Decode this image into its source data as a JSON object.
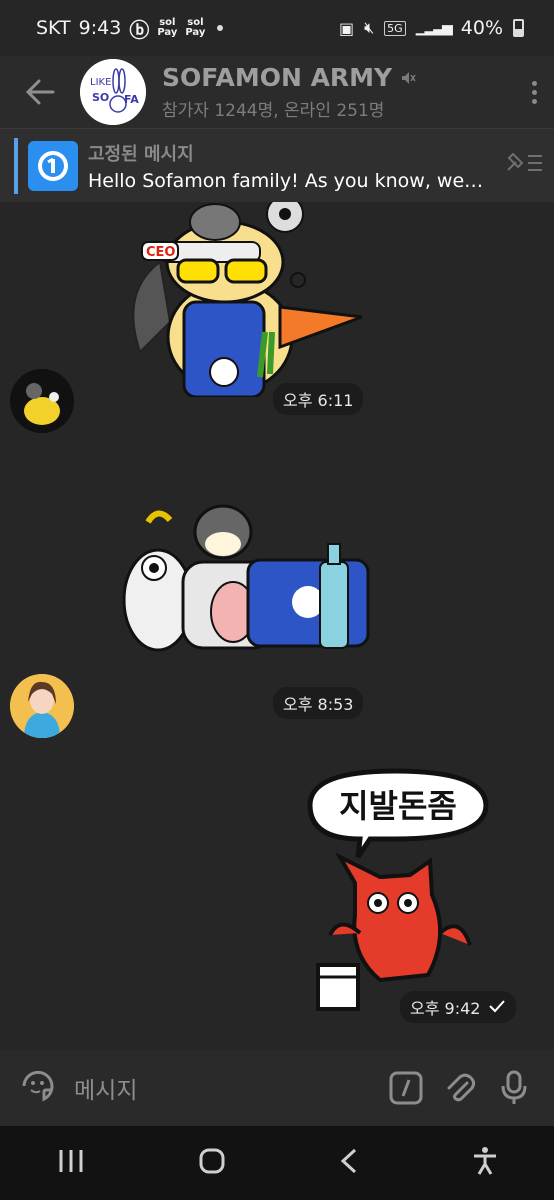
{
  "status": {
    "carrier": "SKT",
    "time": "9:43",
    "pay_a": "Pay",
    "pay_b": "Pay",
    "network": "5G",
    "battery": "40%"
  },
  "header": {
    "title": "SOFAMON ARMY",
    "subtitle": "참가자 1244명, 온라인 251명",
    "avatar_text_a": "LIKE",
    "avatar_text_b": "SO",
    "avatar_text_c": "FA"
  },
  "pinned": {
    "label": "고정된 메시지",
    "message": "Hello Sofamon family!  As you know, we’…"
  },
  "messages": [
    {
      "time": "오후 6:11",
      "sticker_text": "CEO"
    },
    {
      "time": "오후 8:53"
    },
    {
      "time": "오후 9:42",
      "sticker_text": "지발돈좀"
    }
  ],
  "composer": {
    "placeholder": "메시지"
  },
  "icons": {
    "back": "back-arrow-icon",
    "mute": "mute-icon",
    "more": "more-vertical-icon",
    "pin": "pin-list-icon",
    "emoji": "sticker-icon",
    "command": "command-icon",
    "attach": "paperclip-icon",
    "mic": "microphone-icon",
    "recents": "recents-icon",
    "home": "home-icon",
    "nav_back": "nav-back-icon",
    "accessibility": "accessibility-icon"
  },
  "colors": {
    "background": "#262626",
    "pinned_accent": "#5aa0e6",
    "read_check": "#ffffff"
  }
}
